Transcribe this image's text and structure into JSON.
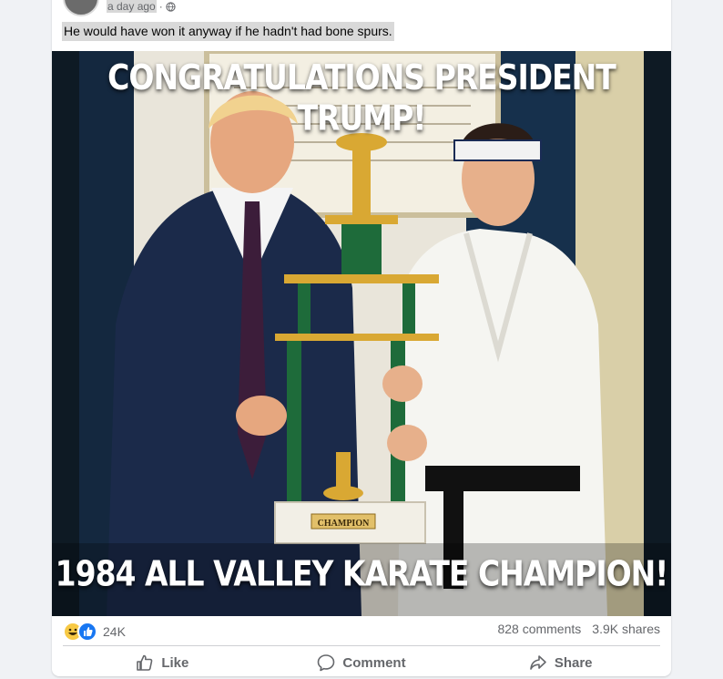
{
  "post": {
    "time": "a day ago",
    "text": "He would have won it anyway if he hadn't had bone spurs."
  },
  "image": {
    "caption_top": "CONGRATULATIONS PRESIDENT TRUMP!",
    "caption_bottom": "1984 ALL VALLEY KARATE CHAMPION!",
    "plaque_text": "CHAMPION"
  },
  "stats": {
    "reaction_count": "24K",
    "comments": "828 comments",
    "shares": "3.9K shares"
  },
  "actions": {
    "like": "Like",
    "comment": "Comment",
    "share": "Share"
  },
  "colors": {
    "like_blue": "#1877f2",
    "haha_yellow": "#f7c945",
    "muted_text": "#65676b",
    "page_bg": "#f0f2f5"
  }
}
